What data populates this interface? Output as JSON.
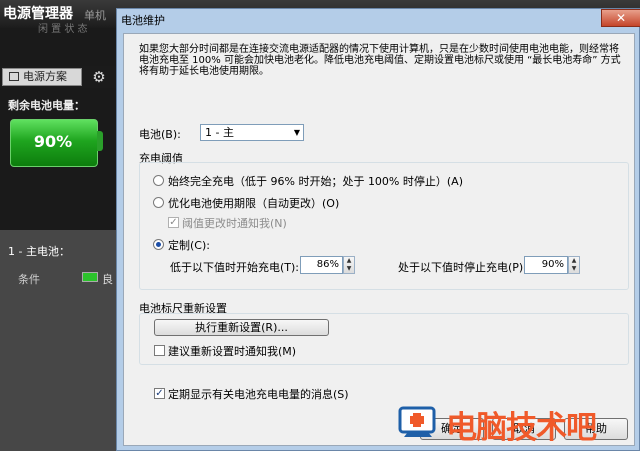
{
  "background_app": {
    "title": "电源管理器",
    "title_right": "单机",
    "sub_title": "闲 置 状 态",
    "scheme_tab": "电源方案",
    "remaining_label": "剩余电池电量：",
    "battery_percent": "90%",
    "battery_level": 0.9,
    "battery1_label": "1 - 主电池：",
    "condition_label": "条件",
    "condition_value": "良"
  },
  "dialog": {
    "title": "电池维护",
    "close_label": "✕",
    "intro": "如果您大部分时间都是在连接交流电源适配器的情况下使用计算机，只是在少数时间使用电池电能，则经常将电池充电至 100% 可能会加快电池老化。降低电池充电阈值、定期设置电池标尺或使用 “最长电池寿命” 方式将有助于延长电池使用期限。",
    "battery_label": "电池(B):",
    "battery_select": "1 - 主",
    "threshold_group": "充电阈值",
    "opt_full": "始终完全充电（低于 96% 时开始；处于 100% 时停止）(A)",
    "opt_optimize": "优化电池使用期限（自动更改）(O)",
    "notify_change": "阈值更改时通知我(N)",
    "opt_custom": "定制(C):",
    "start_label": "低于以下值时开始充电(T):",
    "start_value": "86%",
    "stop_label": "处于以下值时停止充电(P):",
    "stop_value": "90%",
    "gauge_group": "电池标尺重新设置",
    "reset_button": "执行重新设置(R)...",
    "notify_reset": "建议重新设置时通知我(M)",
    "show_messages": "定期显示有关电池充电电量的消息(S)",
    "ok_button": "确定",
    "cancel_button": "取消",
    "help_button": "帮助"
  },
  "watermark": {
    "text": "电脑技术吧"
  },
  "colors": {
    "dialog_frame": "#b4cde8",
    "client_bg": "#f0f0f0",
    "battery_green": "#1fa51f",
    "watermark_orange": "#f05a2a"
  }
}
